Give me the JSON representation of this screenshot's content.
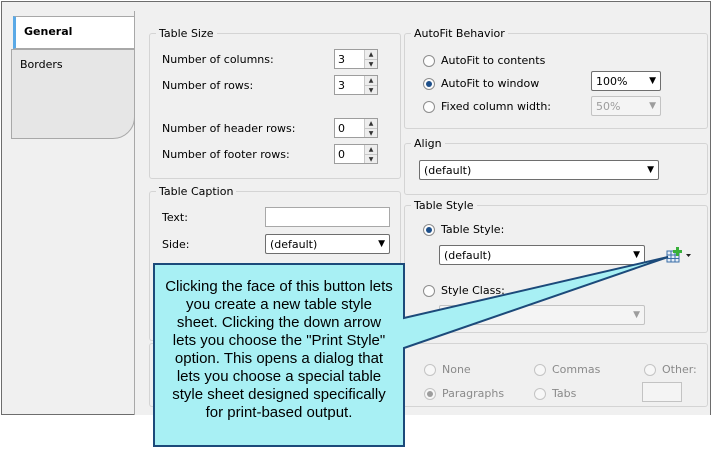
{
  "tabs": [
    {
      "label": "General",
      "active": true
    },
    {
      "label": "Borders",
      "active": false
    }
  ],
  "table_size": {
    "title": "Table Size",
    "columns": {
      "label": "Number of columns:",
      "value": "3"
    },
    "rows": {
      "label": "Number of rows:",
      "value": "3"
    },
    "header_rows": {
      "label": "Number of header rows:",
      "value": "0"
    },
    "footer_rows": {
      "label": "Number of footer rows:",
      "value": "0"
    }
  },
  "autofit": {
    "title": "AutoFit Behavior",
    "contents_label": "AutoFit to contents",
    "window_label": "AutoFit to window",
    "window_value": "100%",
    "fixed_label": "Fixed column width:",
    "fixed_value": "50%"
  },
  "align": {
    "title": "Align",
    "value": "(default)"
  },
  "caption": {
    "title": "Table Caption",
    "text_label": "Text:",
    "text_value": "",
    "side_label": "Side:",
    "side_value": "(default)"
  },
  "table_style": {
    "title": "Table Style",
    "style_label": "Table Style:",
    "style_value": "(default)",
    "class_label": "Style Class:",
    "class_value": ""
  },
  "separator": {
    "none_label": "None",
    "commas_label": "Commas",
    "other_label": "Other:",
    "paragraphs_label": "Paragraphs",
    "tabs_label": "Tabs"
  },
  "callout": {
    "text": "Clicking the face of this button lets you create a new table style sheet. Clicking the down arrow lets you choose the \"Print Style\" option. This opens a dialog that lets you choose a special table style sheet designed specifically for print-based output."
  },
  "colors": {
    "callout_fill": "#a8f0f4",
    "callout_border": "#1c4a7a"
  }
}
